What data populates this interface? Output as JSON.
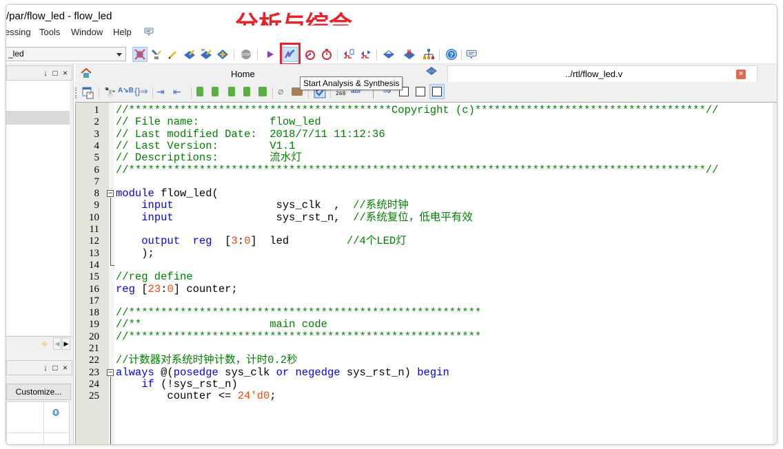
{
  "window": {
    "title": "/par/flow_led - flow_led"
  },
  "menubar": {
    "items": [
      "essing",
      "Tools",
      "Window",
      "Help"
    ],
    "feedback_icon": "feedback-icon"
  },
  "annotation": {
    "text": "分析与综合",
    "color": "#e8222a"
  },
  "toolbar": {
    "entity_combo_value": "_led",
    "buttons": [
      {
        "name": "pin-planner-icon"
      },
      {
        "name": "chip-planner-icon"
      },
      {
        "name": "design-partition-icon"
      },
      {
        "name": "compile-design-icon"
      },
      {
        "name": "programmer-icon"
      },
      {
        "name": "assignment-editor-icon"
      },
      {
        "name": "stop-icon"
      },
      {
        "name": "start-compilation-icon"
      },
      {
        "name": "start-analysis-synthesis-icon"
      },
      {
        "name": "timing-analyzer-icon"
      },
      {
        "name": "timequest-icon"
      },
      {
        "name": "signaltap-icon"
      },
      {
        "name": "simulation-icon"
      },
      {
        "name": "netlist-viewer-icon"
      },
      {
        "name": "rtl-viewer-icon"
      },
      {
        "name": "hierarchy-icon"
      },
      {
        "name": "help-icon"
      },
      {
        "name": "feedback-icon"
      }
    ]
  },
  "tooltip": {
    "text": "Start Analysis & Synthesis"
  },
  "left_panel": {
    "top_controls": "↓ □ ×",
    "bottom_controls": "↓ □ ×",
    "customize_label": "Customize..."
  },
  "tabs": [
    {
      "label": "Home",
      "icon": "home-icon",
      "active": false
    },
    {
      "label": "../rtl/flow_led.v",
      "icon": "verilog-file-icon",
      "active": true
    }
  ],
  "tab_close_symbol": "×",
  "code_lines": [
    {
      "n": "1",
      "segs": [
        {
          "t": "//*****************************************Copyright (c)************************************//",
          "c": "c-comment"
        }
      ]
    },
    {
      "n": "2",
      "segs": [
        {
          "t": "// File name:           flow_led",
          "c": "c-comment"
        }
      ]
    },
    {
      "n": "3",
      "segs": [
        {
          "t": "// Last modified Date:  2018/7/11 11:12:36",
          "c": "c-comment"
        }
      ]
    },
    {
      "n": "4",
      "segs": [
        {
          "t": "// Last Version:        V1.1",
          "c": "c-comment"
        }
      ]
    },
    {
      "n": "5",
      "segs": [
        {
          "t": "// Descriptions:        流水灯",
          "c": "c-comment"
        }
      ]
    },
    {
      "n": "6",
      "segs": [
        {
          "t": "//******************************************************************************************//",
          "c": "c-comment"
        }
      ]
    },
    {
      "n": "7",
      "segs": []
    },
    {
      "n": "8",
      "fold": "start",
      "segs": [
        {
          "t": "module",
          "c": "c-kw"
        },
        {
          "t": " flow_led(",
          "c": "c-plain"
        }
      ]
    },
    {
      "n": "9",
      "segs": [
        {
          "t": "    ",
          "c": "c-plain"
        },
        {
          "t": "input",
          "c": "c-kw"
        },
        {
          "t": "                sys_clk  ,  ",
          "c": "c-plain"
        },
        {
          "t": "//系统时钟",
          "c": "c-comment"
        }
      ]
    },
    {
      "n": "10",
      "segs": [
        {
          "t": "    ",
          "c": "c-plain"
        },
        {
          "t": "input",
          "c": "c-kw"
        },
        {
          "t": "                sys_rst_n,  ",
          "c": "c-plain"
        },
        {
          "t": "//系统复位，低电平有效",
          "c": "c-comment"
        }
      ]
    },
    {
      "n": "11",
      "segs": []
    },
    {
      "n": "12",
      "segs": [
        {
          "t": "    ",
          "c": "c-plain"
        },
        {
          "t": "output",
          "c": "c-kw"
        },
        {
          "t": "  ",
          "c": "c-plain"
        },
        {
          "t": "reg",
          "c": "c-kw"
        },
        {
          "t": "  [",
          "c": "c-plain"
        },
        {
          "t": "3",
          "c": "c-num"
        },
        {
          "t": ":",
          "c": "c-plain"
        },
        {
          "t": "0",
          "c": "c-num"
        },
        {
          "t": "]  led         ",
          "c": "c-plain"
        },
        {
          "t": "//4个LED灯",
          "c": "c-comment"
        }
      ]
    },
    {
      "n": "13",
      "segs": [
        {
          "t": "    );",
          "c": "c-plain"
        }
      ]
    },
    {
      "n": "14",
      "fold": "end",
      "segs": []
    },
    {
      "n": "15",
      "segs": [
        {
          "t": "//reg define",
          "c": "c-comment"
        }
      ]
    },
    {
      "n": "16",
      "segs": [
        {
          "t": "reg",
          "c": "c-kw"
        },
        {
          "t": " [",
          "c": "c-plain"
        },
        {
          "t": "23",
          "c": "c-num"
        },
        {
          "t": ":",
          "c": "c-plain"
        },
        {
          "t": "0",
          "c": "c-num"
        },
        {
          "t": "] counter;",
          "c": "c-plain"
        }
      ]
    },
    {
      "n": "17",
      "segs": []
    },
    {
      "n": "18",
      "segs": [
        {
          "t": "//*******************************************************",
          "c": "c-comment"
        }
      ]
    },
    {
      "n": "19",
      "segs": [
        {
          "t": "//**                    main code",
          "c": "c-comment"
        }
      ]
    },
    {
      "n": "20",
      "segs": [
        {
          "t": "//*******************************************************",
          "c": "c-comment"
        }
      ]
    },
    {
      "n": "21",
      "segs": []
    },
    {
      "n": "22",
      "segs": [
        {
          "t": "//计数器对系统时钟计数，计时0.2秒",
          "c": "c-comment"
        }
      ]
    },
    {
      "n": "23",
      "fold": "start",
      "segs": [
        {
          "t": "always",
          "c": "c-kw"
        },
        {
          "t": " @(",
          "c": "c-plain"
        },
        {
          "t": "posedge",
          "c": "c-kw"
        },
        {
          "t": " sys_clk ",
          "c": "c-plain"
        },
        {
          "t": "or",
          "c": "c-kw"
        },
        {
          "t": " ",
          "c": "c-plain"
        },
        {
          "t": "negedge",
          "c": "c-kw"
        },
        {
          "t": " sys_rst_n) ",
          "c": "c-plain"
        },
        {
          "t": "begin",
          "c": "c-kw"
        }
      ]
    },
    {
      "n": "24",
      "segs": [
        {
          "t": "    ",
          "c": "c-plain"
        },
        {
          "t": "if",
          "c": "c-kw"
        },
        {
          "t": " (!sys_rst_n)",
          "c": "c-plain"
        }
      ]
    },
    {
      "n": "25",
      "segs": [
        {
          "t": "        counter <= ",
          "c": "c-plain"
        },
        {
          "t": "24'd0",
          "c": "c-num"
        },
        {
          "t": ";",
          "c": "c-plain"
        }
      ]
    }
  ]
}
